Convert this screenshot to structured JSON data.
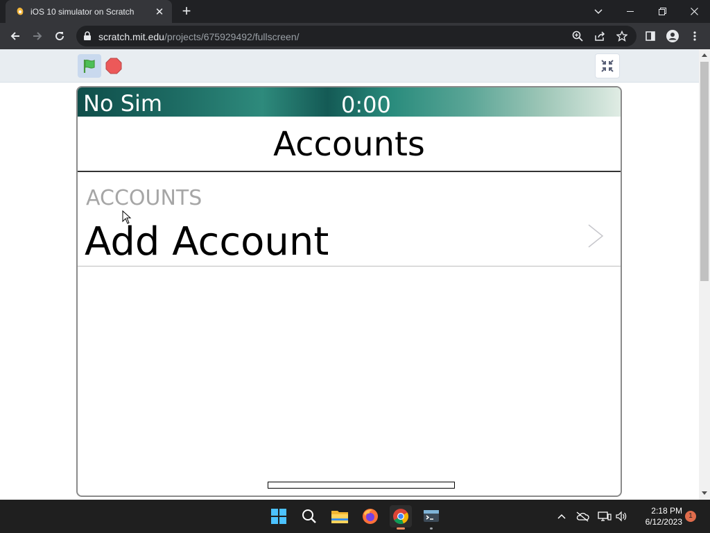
{
  "browser": {
    "tab_title": "iOS 10 simulator on Scratch",
    "tab_close": "✕",
    "new_tab": "+",
    "url_host": "scratch.mit.edu",
    "url_path": "/projects/675929492/fullscreen/"
  },
  "scratch": {
    "project": {
      "status_carrier": "No Sim",
      "status_time": "0:00",
      "nav_title": "Accounts",
      "section_header": "ACCOUNTS",
      "row_label": "Add Account"
    }
  },
  "taskbar": {
    "time": "2:18 PM",
    "date": "6/12/2023",
    "notification_count": "1"
  },
  "colors": {
    "chrome_dark": "#202124",
    "chrome_tab": "#35363a",
    "scratch_bar": "#e8edf1",
    "flag_green": "#4cbf56",
    "stop_red": "#ec5959",
    "taskbar": "#1f1f1f"
  },
  "icons": [
    "scratch-favicon-icon",
    "back-icon",
    "forward-icon",
    "reload-icon",
    "lock-icon",
    "zoom-icon",
    "share-icon",
    "star-icon",
    "side-panel-icon",
    "profile-icon",
    "menu-icon",
    "green-flag-icon",
    "stop-icon",
    "exit-fullscreen-icon",
    "chevron-right-icon",
    "windows-start-icon",
    "search-icon",
    "file-explorer-icon",
    "firefox-icon",
    "chrome-icon",
    "terminal-icon",
    "chevron-up-icon",
    "cloud-off-icon",
    "network-icon",
    "volume-icon"
  ]
}
